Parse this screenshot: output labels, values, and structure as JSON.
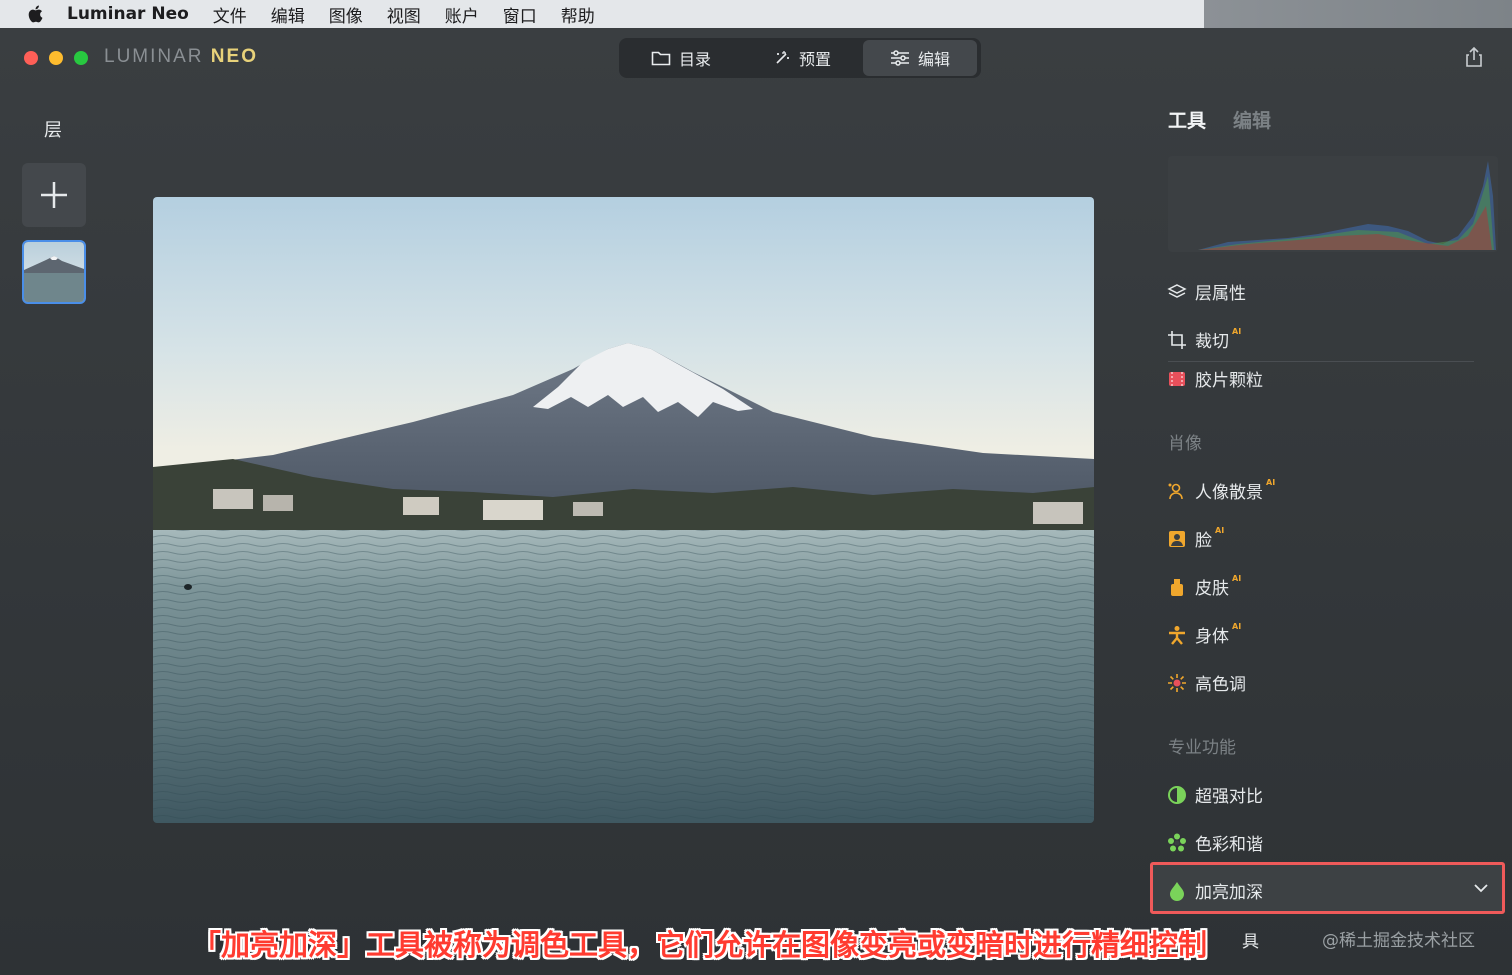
{
  "menubar": {
    "app_name": "Luminar Neo",
    "items": [
      "文件",
      "编辑",
      "图像",
      "视图",
      "账户",
      "窗口",
      "帮助"
    ]
  },
  "window": {
    "logo_main": "LUMINAR",
    "logo_accent": "NEO",
    "segments": [
      {
        "label": "目录",
        "icon": "folder-icon"
      },
      {
        "label": "预置",
        "icon": "sparkle-icon"
      },
      {
        "label": "编辑",
        "icon": "sliders-icon"
      }
    ],
    "active_segment": "编辑"
  },
  "layers": {
    "title": "层"
  },
  "right_panel": {
    "tabs": [
      "工具",
      "编辑"
    ],
    "active_tab": "工具",
    "tools_top": [
      {
        "label": "层属性",
        "icon": "layers-icon",
        "ai": ""
      },
      {
        "label": "裁切",
        "icon": "crop-icon",
        "ai": "AI"
      },
      {
        "label": "胶片颗粒",
        "icon": "film-icon",
        "ai": ""
      }
    ],
    "section_portrait": "肖像",
    "tools_portrait": [
      {
        "label": "人像散景",
        "icon": "portrait-bokeh-icon",
        "ai": "AI"
      },
      {
        "label": "脸",
        "icon": "face-icon",
        "ai": "AI"
      },
      {
        "label": "皮肤",
        "icon": "skin-icon",
        "ai": "AI"
      },
      {
        "label": "身体",
        "icon": "body-icon",
        "ai": "AI"
      },
      {
        "label": "高色调",
        "icon": "high-key-icon",
        "ai": ""
      }
    ],
    "section_pro": "专业功能",
    "tools_pro": [
      {
        "label": "超强对比",
        "icon": "contrast-icon",
        "ai": ""
      },
      {
        "label": "色彩和谐",
        "icon": "color-harmony-icon",
        "ai": ""
      },
      {
        "label": "加亮加深",
        "icon": "dodge-burn-icon",
        "ai": ""
      }
    ],
    "partial_tool": "具"
  },
  "caption": "「加亮加深」工具被称为调色工具，它们允许在图像变亮或变暗时进行精细控制",
  "watermark": "@稀土掘金技术社区",
  "colors": {
    "accent_blue": "#4a8ee8",
    "highlight_red": "#ef5a5a",
    "caption_red": "#ff3b30",
    "ai_orange": "#f0a72d"
  }
}
